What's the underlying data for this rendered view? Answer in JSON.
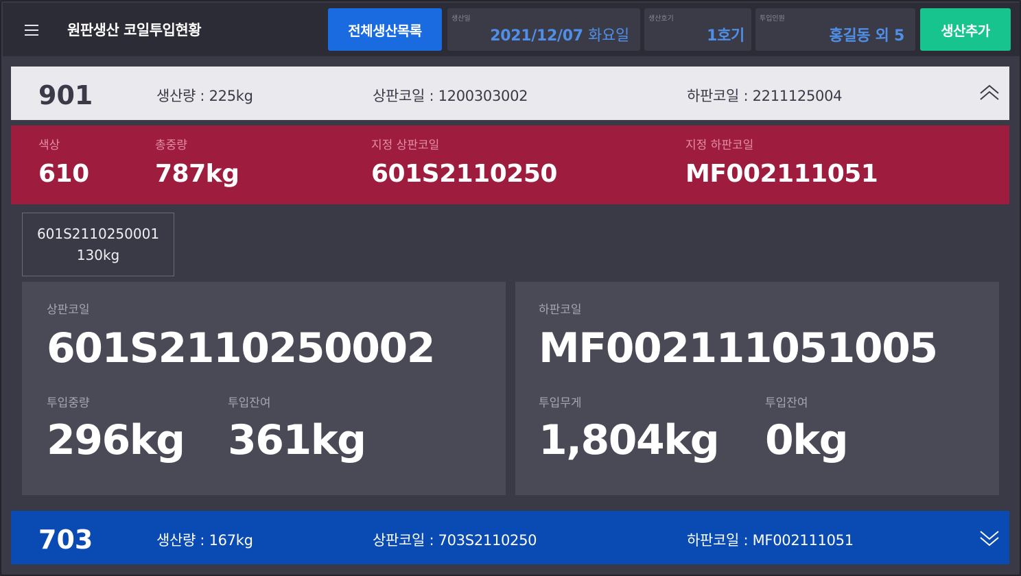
{
  "header": {
    "title": "원판생산 코일투입현황",
    "list_button": "전체생산목록",
    "production_date": {
      "caption": "생산일",
      "value": "2021/12/07",
      "weekday": "화요일"
    },
    "line": {
      "caption": "생산호기",
      "value": "1호기"
    },
    "workers": {
      "caption": "투입인원",
      "value": "홍길동 외 5"
    },
    "add_button": "생산추가"
  },
  "rows": [
    {
      "number": "901",
      "output": "생산량 : 225kg",
      "top_coil": "상판코일 : 1200303002",
      "bottom_coil": "하판코일 : 2211125004",
      "expanded": true
    },
    {
      "number": "703",
      "output": "생산량 : 167kg",
      "top_coil": "상판코일 : 703S2110250",
      "bottom_coil": "하판코일 : MF002111051",
      "expanded": false
    }
  ],
  "detail": {
    "color_label": "색상",
    "color_value": "610",
    "total_weight_label": "총중량",
    "total_weight_value": "787kg",
    "assigned_top_label": "지정 상판코일",
    "assigned_top_value": "601S2110250",
    "assigned_bottom_label": "지정 하판코일",
    "assigned_bottom_value": "MF002111051"
  },
  "used_coil": {
    "code": "601S2110250001",
    "weight": "130kg"
  },
  "top_panel": {
    "label": "상판코일",
    "code": "601S2110250002",
    "input_label": "투입중량",
    "input_value": "296kg",
    "remain_label": "투입잔여",
    "remain_value": "361kg"
  },
  "bottom_panel": {
    "label": "하판코일",
    "code": "MF002111051005",
    "input_label": "투입무게",
    "input_value": "1,804kg",
    "remain_label": "투입잔여",
    "remain_value": "0kg"
  },
  "colors": {
    "primary": "#1a6be0",
    "add": "#17c48e",
    "detail_band": "#9e1d3f",
    "collapsed_row": "#0a4bb3",
    "expanded_row": "#e9e9ee"
  }
}
